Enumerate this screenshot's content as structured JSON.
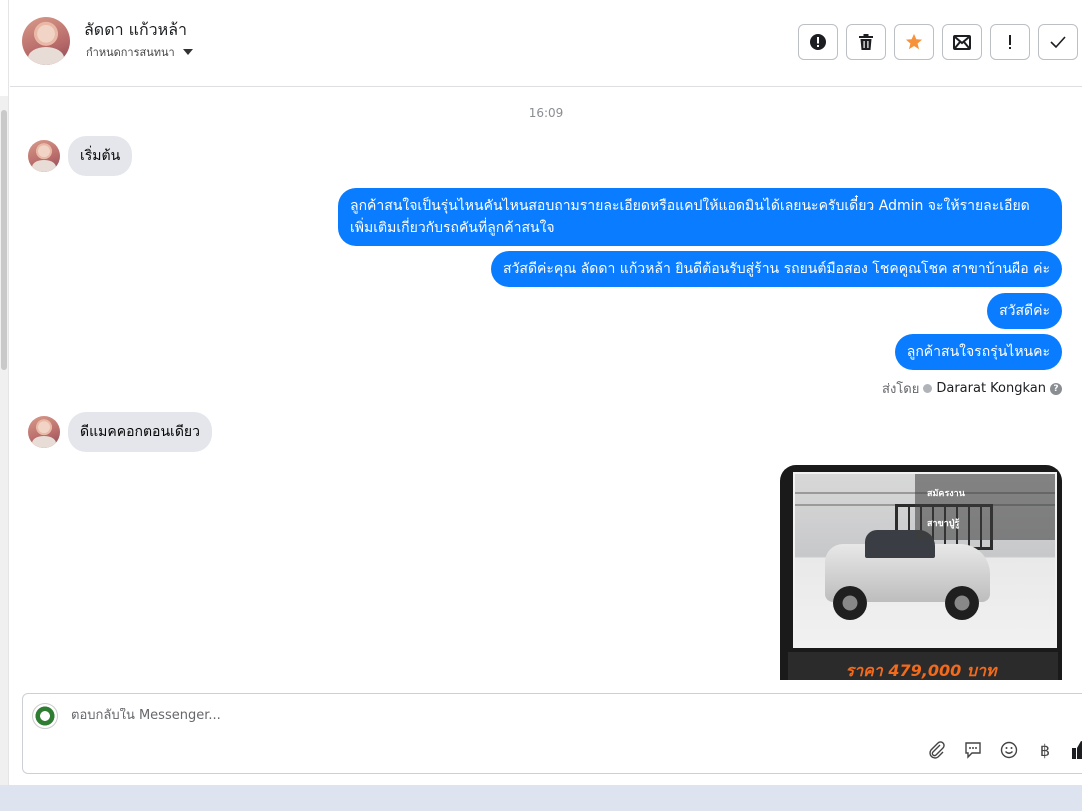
{
  "header": {
    "contact_name": "ลัดดา แก้วหล้า",
    "conversation_settings": "กำหนดการสนทนา",
    "actions": [
      {
        "icon": "alert-circle-icon",
        "name": "report-spam-button"
      },
      {
        "icon": "trash-icon",
        "name": "delete-button"
      },
      {
        "icon": "star-icon",
        "name": "star-button"
      },
      {
        "icon": "mark-unread-icon",
        "name": "mark-unread-button"
      },
      {
        "icon": "exclamation-icon",
        "name": "follow-up-button"
      },
      {
        "icon": "check-icon",
        "name": "done-button"
      }
    ],
    "star_color": "#f7923a"
  },
  "thread": {
    "timestamp": "16:09",
    "incoming_1": "เริ่มต้น",
    "outgoing": [
      "ลูกค้าสนใจเป็นรุ่นไหนคันไหนสอบถามรายละเอียดหรือแคปให้แอดมินได้เลยนะครับเดี๋ยว Admin จะให้รายละเอียดเพิ่มเติมเกี่ยวกับรถคันที่ลูกค้าสนใจ",
      "สวัสดีค่ะคุณ ลัดดา แก้วหล้า ยินดีต้อนรับสู่ร้าน รถยนต์มือสอง โชคคูณโชค สาขาบ้านผือ ค่ะ",
      "สวัสดีค่ะ",
      "ลูกค้าสนใจรถรุ่นไหนคะ"
    ],
    "sent_by_label": "ส่งโดย",
    "sent_by_name": "Dararat Kongkan",
    "incoming_2": "ดีแมคคอกตอนเดียว",
    "car_card": {
      "tag_top": "สมัครงาน",
      "tag_bottom": "สาขาปู่รู้",
      "price": "ราคา 479,000 บาท"
    },
    "outgoing_color": "#0a7cff",
    "incoming_color": "#e4e6eb"
  },
  "composer": {
    "placeholder": "ตอบกลับใน Messenger...",
    "tools": [
      "paperclip-icon",
      "chat-bubble-icon",
      "smiley-icon",
      "baht-icon",
      "thumbs-up-icon"
    ],
    "baht_symbol": "฿"
  }
}
